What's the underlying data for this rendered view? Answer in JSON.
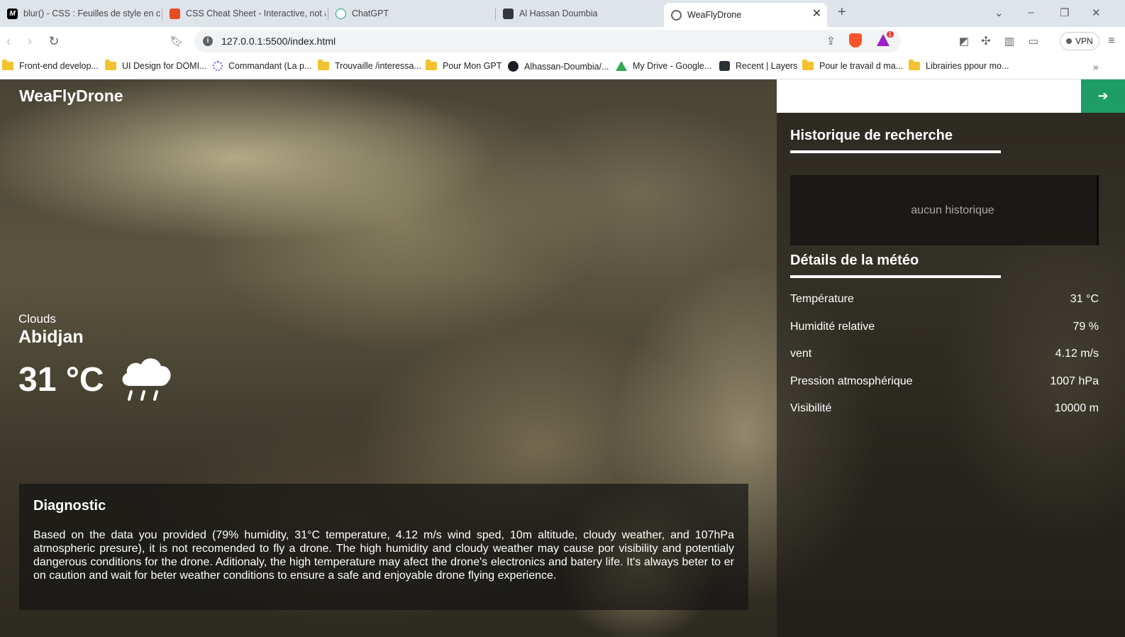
{
  "browser": {
    "tabs": [
      {
        "title": "blur() - CSS : Feuilles de style en casc",
        "icon": "mdn-icon"
      },
      {
        "title": "CSS Cheat Sheet - Interactive, not a",
        "icon": "html-shield-icon"
      },
      {
        "title": "ChatGPT",
        "icon": "chatgpt-icon"
      },
      {
        "title": "Al Hassan Doumbia",
        "icon": "profile-image-icon"
      },
      {
        "title": "WeaFlyDrone",
        "icon": "globe-icon"
      }
    ],
    "url": "127.0.0.1:5500/index.html",
    "brave_badge": "1",
    "vpn_label": "VPN",
    "bookmarks": [
      {
        "label": "Front-end develop...",
        "icon": "folder-icon"
      },
      {
        "label": "UI Design for DOMI...",
        "icon": "folder-icon"
      },
      {
        "label": "Commandant (La p...",
        "icon": "site-icon"
      },
      {
        "label": "Trouvaille /interessa...",
        "icon": "folder-icon"
      },
      {
        "label": "Pour Mon GPT",
        "icon": "folder-icon"
      },
      {
        "label": "Alhassan-Doumbia/...",
        "icon": "github-icon"
      },
      {
        "label": "My Drive - Google...",
        "icon": "google-drive-icon"
      },
      {
        "label": "Recent | Layers",
        "icon": "layers-icon"
      },
      {
        "label": "Pour le travail d ma...",
        "icon": "folder-icon"
      },
      {
        "label": "Librairies ppour mo...",
        "icon": "folder-icon"
      }
    ]
  },
  "app": {
    "logo": "WeaFlyDrone",
    "current": {
      "condition": "Clouds",
      "city": "Abidjan",
      "temperature": "31 °C",
      "weather_icon": "rain-cloud-icon"
    },
    "diagnostic": {
      "title": "Diagnostic",
      "text": "Based on the data you provided (79% humidity, 31°C temperature, 4.12 m/s wind sped, 10m altitude, cloudy weather, and 107hPa atmospheric presure), it is not recomended to fly a drone. The high humidity and cloudy weather may cause por visibility and potentialy dangerous conditions for the drone. Aditionaly, the high temperature may afect the drone's electronics and batery life. It's always beter to er on caution and wait for beter weather conditions to ensure a safe and enjoyable drone flying experience."
    },
    "search": {
      "placeholder": "",
      "button_icon": "arrow-right-icon"
    },
    "history": {
      "title": "Historique de recherche",
      "empty_text": "aucun historique"
    },
    "details": {
      "title": "Détails de la météo",
      "rows": [
        {
          "label": "Température",
          "value": "31 °C"
        },
        {
          "label": "Humidité relative",
          "value": "79 %"
        },
        {
          "label": "vent",
          "value": "4.12 m/s"
        },
        {
          "label": "Pression atmosphérique",
          "value": "1007 hPa"
        },
        {
          "label": "Visibilité",
          "value": "10000 m"
        }
      ]
    },
    "colors": {
      "accent": "#1f9d68",
      "text": "#ffffff",
      "muted": "#a8a8a8"
    }
  }
}
